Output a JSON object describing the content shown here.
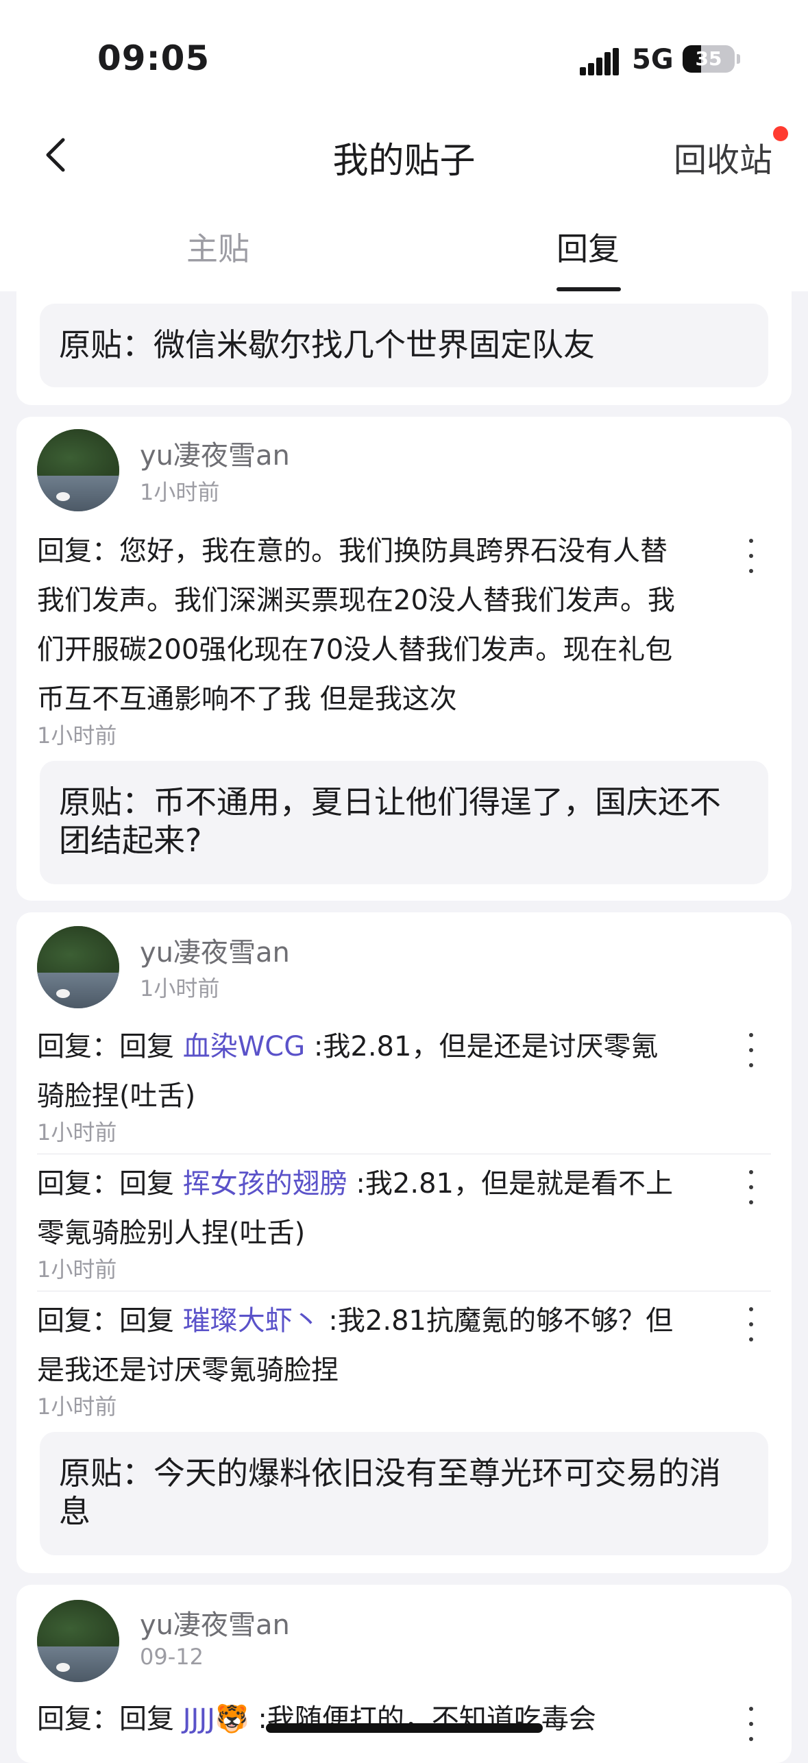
{
  "status_bar": {
    "time": "09:05",
    "network": "5G",
    "battery": "35",
    "battery_level": 0.35
  },
  "nav": {
    "title": "我的贴子",
    "recycle_label": "回收站"
  },
  "tabs": [
    {
      "label": "主贴"
    },
    {
      "label": "回复"
    }
  ],
  "cards": [
    {
      "original": "原贴：微信米歇尔找几个世界固定队友"
    },
    {
      "user": "yu凄夜雪an",
      "time": "1小时前",
      "replies": [
        {
          "text": "回复：您好，我在意的。我们换防具跨界石没有人替我们发声。我们深渊买票现在20没人替我们发声。我们开服碳200强化现在70没人替我们发声。现在礼包币互不互通影响不了我 但是我这次",
          "time": "1小时前"
        }
      ],
      "original": "原贴：币不通用，夏日让他们得逞了，国庆还不团结起来?"
    },
    {
      "user": "yu凄夜雪an",
      "time": "1小时前",
      "replies": [
        {
          "prefix": "回复：回复 ",
          "mention": "血染WCG",
          "text": " :我2.81，但是还是讨厌零氪骑脸捏(吐舌)",
          "time": "1小时前"
        },
        {
          "prefix": "回复：回复 ",
          "mention": "挥女孩的翅膀",
          "text": " :我2.81，但是就是看不上零氪骑脸别人捏(吐舌)",
          "time": "1小时前"
        },
        {
          "prefix": "回复：回复 ",
          "mention": "璀璨大虾丶",
          "text": " :我2.81抗魔氪的够不够？但是我还是讨厌零氪骑脸捏",
          "time": "1小时前"
        }
      ],
      "original": "原贴：今天的爆料依旧没有至尊光环可交易的消息"
    },
    {
      "user": "yu凄夜雪an",
      "time": "09-12",
      "replies": [
        {
          "prefix": "回复：回复 ",
          "mention": "JJJJ🐯",
          "text": " :我随便打的，不知道吃毒会"
        }
      ]
    }
  ],
  "icons": {
    "back": "chevron-left-icon",
    "more": "more-vertical-icon"
  },
  "colors": {
    "accent": "#5a52c9",
    "badge": "#ff3b30",
    "background": "#f3f3f7"
  }
}
